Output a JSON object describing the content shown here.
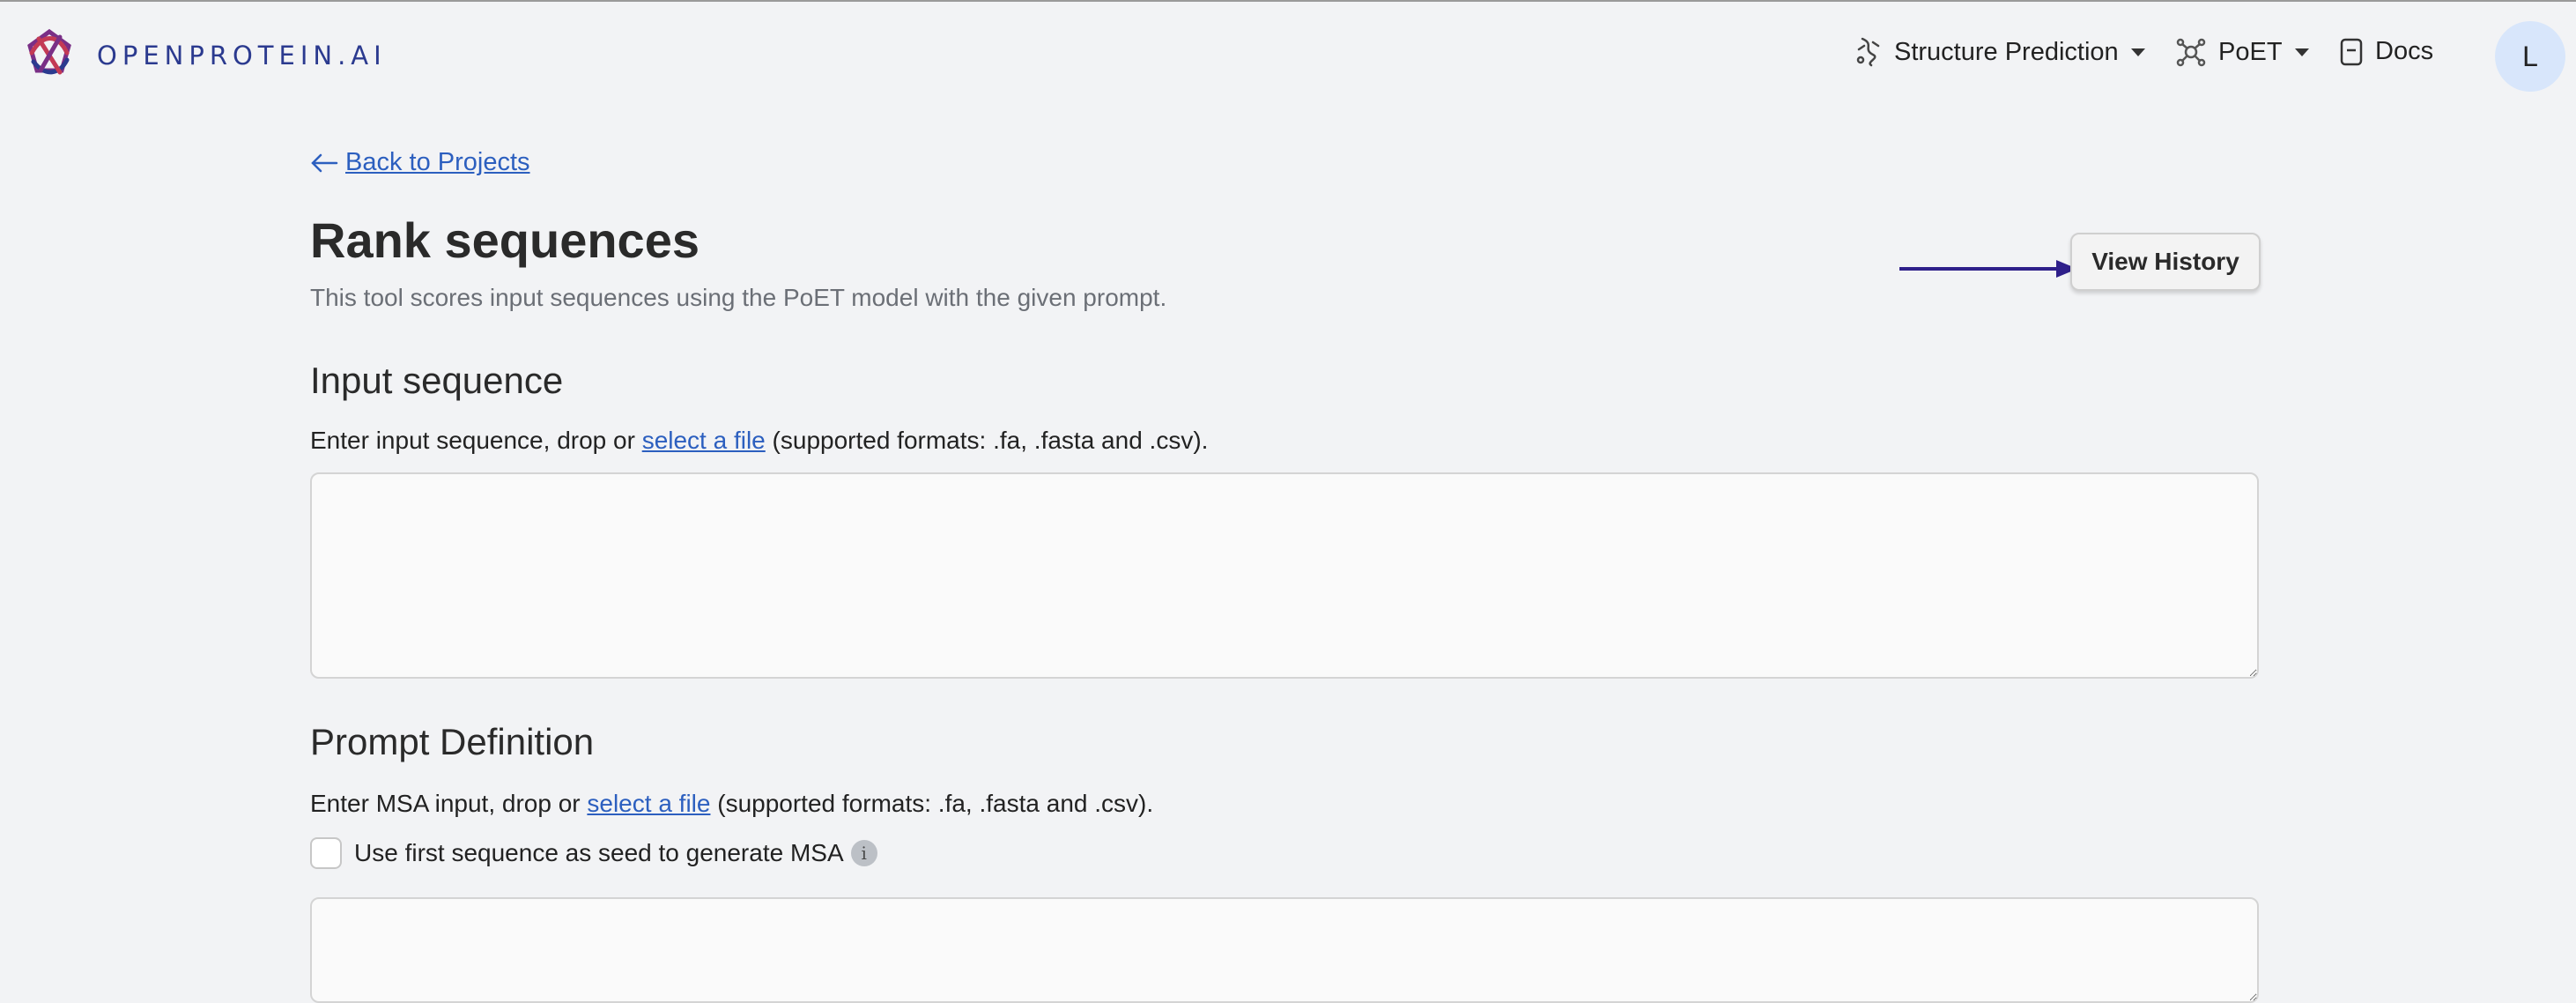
{
  "header": {
    "brand": "OPENPROTEIN.AI",
    "nav": {
      "structure_prediction": "Structure Prediction",
      "poet": "PoET",
      "docs": "Docs"
    },
    "avatar_initial": "L"
  },
  "page": {
    "back_link": "Back to Projects",
    "title": "Rank sequences",
    "subtitle": "This tool scores input sequences using the PoET model with the given prompt.",
    "view_history_label": "View History"
  },
  "input_section": {
    "title": "Input sequence",
    "help_prefix": "Enter input sequence, drop or ",
    "help_link": "select a file",
    "help_suffix": " (supported formats: .fa, .fasta and .csv).",
    "value": ""
  },
  "prompt_section": {
    "title": "Prompt Definition",
    "help_prefix": "Enter MSA input, drop or ",
    "help_link": "select a file",
    "help_suffix": " (supported formats: .fa, .fasta and .csv).",
    "checkbox_label": "Use first sequence as seed to generate MSA",
    "checkbox_checked": false,
    "info_glyph": "i",
    "value": ""
  },
  "icons": {
    "logo": "openprotein-logo-icon",
    "structure": "structure-prediction-icon",
    "poet": "poet-molecule-icon",
    "docs": "docs-icon",
    "back": "arrow-left-icon",
    "info": "info-icon"
  },
  "colors": {
    "background": "#f2f3f5",
    "brand": "#2b3a8f",
    "link": "#2c5fbf",
    "annotation_arrow": "#2e1f8a",
    "avatar_bg": "#d8e6fb"
  }
}
